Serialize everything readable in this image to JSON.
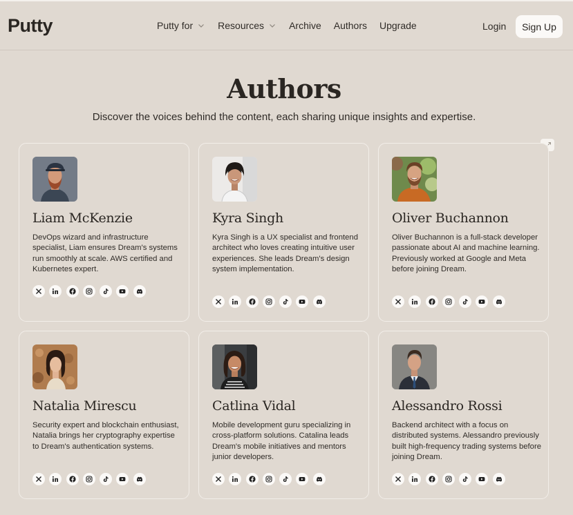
{
  "header": {
    "logo": "Putty",
    "nav": [
      {
        "label": "Putty for",
        "has_dropdown": true
      },
      {
        "label": "Resources",
        "has_dropdown": true
      },
      {
        "label": "Archive",
        "has_dropdown": false
      },
      {
        "label": "Authors",
        "has_dropdown": false
      },
      {
        "label": "Upgrade",
        "has_dropdown": false
      }
    ],
    "login": "Login",
    "signup": "Sign Up"
  },
  "page": {
    "title": "Authors",
    "subtitle": "Discover the voices behind the content, each sharing unique insights and expertise."
  },
  "social_icons": [
    "x-icon",
    "linkedin-icon",
    "facebook-icon",
    "instagram-icon",
    "tiktok-icon",
    "youtube-icon",
    "discord-icon"
  ],
  "colors": {
    "background": "#e0d9d1",
    "card_border": "#f2eee9",
    "button_bg": "#fbf9f7",
    "text": "#2a2622"
  },
  "authors": [
    {
      "name": "Liam McKenzie",
      "bio": "DevOps wizard and infrastructure specialist, Liam ensures Dream's systems run smoothly at scale. AWS certified and Kubernetes expert."
    },
    {
      "name": "Kyra Singh",
      "bio": "Kyra Singh is a UX specialist and frontend architect who loves creating intuitive user experiences. She leads Dream's design system implementation."
    },
    {
      "name": "Oliver Buchannon",
      "bio": "Oliver Buchannon is a full-stack developer passionate about AI and machine learning. Previously worked at Google and Meta before joining Dream."
    },
    {
      "name": "Natalia Mirescu",
      "bio": "Security expert and blockchain enthusiast, Natalia brings her cryptography expertise to Dream's authentication systems."
    },
    {
      "name": "Catlina Vidal",
      "bio": "Mobile development guru specializing in cross-platform solutions. Catalina leads Dream's mobile initiatives and mentors junior developers."
    },
    {
      "name": "Alessandro Rossi",
      "bio": "Backend architect with a focus on distributed systems. Alessandro previously built high-frequency trading systems before joining Dream."
    }
  ]
}
